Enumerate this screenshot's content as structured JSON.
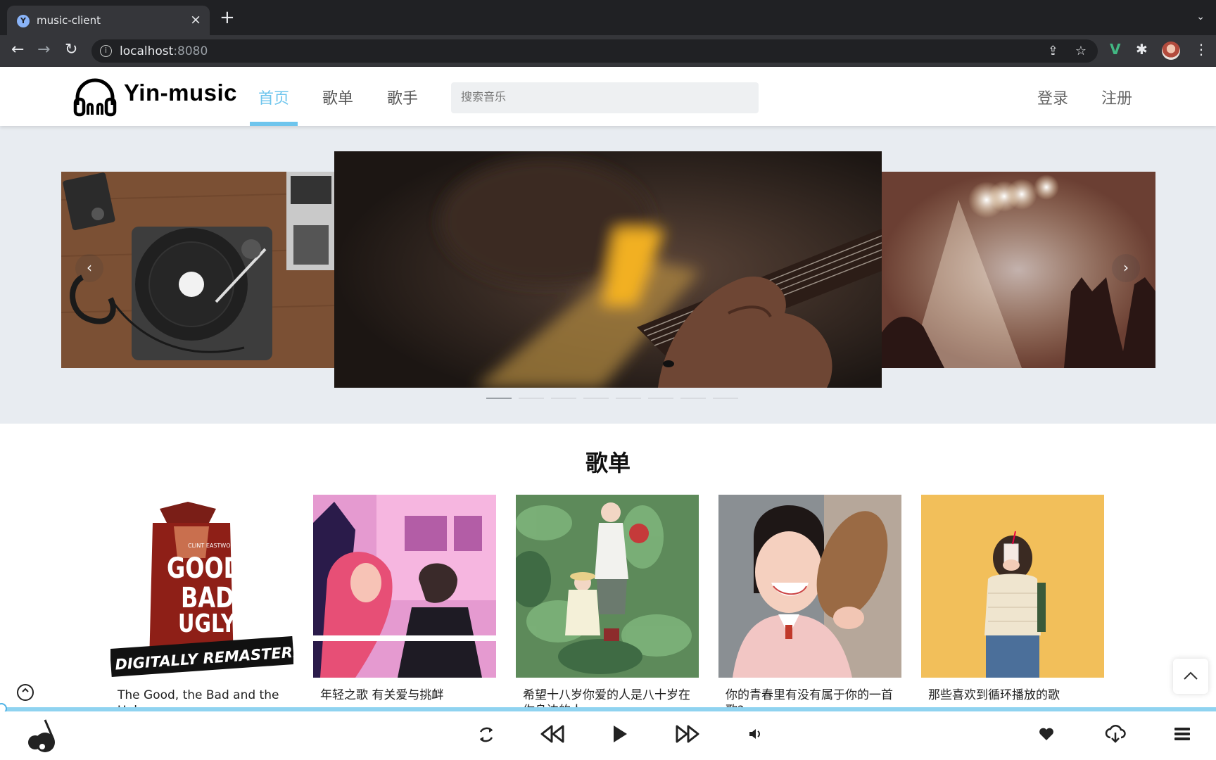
{
  "browser": {
    "tab_title": "music-client",
    "url_host": "localhost",
    "url_port": ":8080"
  },
  "header": {
    "logo_text": "Yin-music",
    "nav": [
      "首页",
      "歌单",
      "歌手"
    ],
    "active_nav": "首页",
    "search_placeholder": "搜索音乐",
    "login": "登录",
    "register": "注册"
  },
  "carousel": {
    "slide_count": 8,
    "active_index": 0,
    "prev_glyph": "‹",
    "next_glyph": "›"
  },
  "playlists": {
    "title": "歌单",
    "items": [
      {
        "label": "The Good, the Bad and the Ugly"
      },
      {
        "label": "年轻之歌 有关爱与挑衅"
      },
      {
        "label": "希望十八岁你爱的人是八十岁在你身边的人"
      },
      {
        "label": "你的青春里有没有属于你的一首歌?"
      },
      {
        "label": "那些喜欢到循环播放的歌"
      }
    ],
    "cover1_text": {
      "top": "CLINT EASTWOOD",
      "main1": "GOOD",
      "main2": "BAD",
      "main3": "UGLY",
      "banner": "DIGITALLY REMASTERED"
    }
  },
  "player": {
    "progress": 0,
    "accent": "#6ec5ed"
  }
}
